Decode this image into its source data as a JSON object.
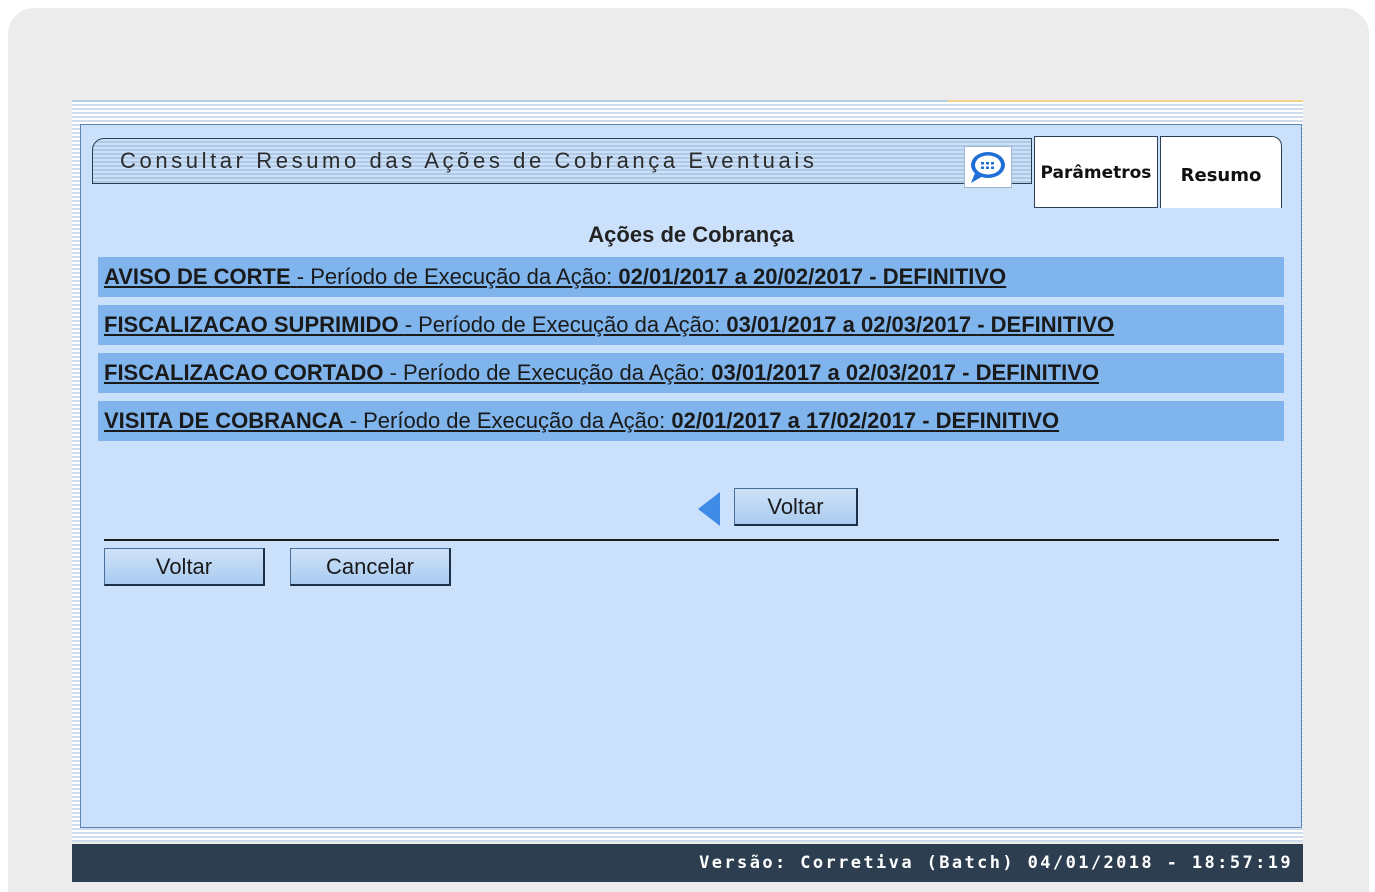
{
  "header": {
    "title": "Consultar Resumo das Ações de Cobrança Eventuais",
    "tabs": [
      {
        "label": "Parâmetros"
      },
      {
        "label": "Resumo"
      }
    ]
  },
  "main": {
    "heading": "Ações de Cobrança",
    "period_prefix": "- Período de Execução da Ação:",
    "separator": "a",
    "actions": [
      {
        "name": "AVISO DE CORTE",
        "start": "02/01/2017",
        "end": "20/02/2017",
        "status": "DEFINITIVO"
      },
      {
        "name": "FISCALIZACAO SUPRIMIDO",
        "start": "03/01/2017",
        "end": "02/03/2017",
        "status": "DEFINITIVO"
      },
      {
        "name": "FISCALIZACAO CORTADO",
        "start": "03/01/2017",
        "end": "02/03/2017",
        "status": "DEFINITIVO"
      },
      {
        "name": "VISITA DE COBRANCA",
        "start": "02/01/2017",
        "end": "17/02/2017",
        "status": "DEFINITIVO"
      }
    ],
    "back_button": "Voltar"
  },
  "buttons": {
    "voltar": "Voltar",
    "cancelar": "Cancelar"
  },
  "footer": {
    "version": "Versão: Corretiva (Batch) 04/01/2018 - 18:57:19"
  },
  "colors": {
    "panel_bg": "#cbe1fb",
    "row_bg": "#7fb4ec",
    "footer_bg": "#2c3e50",
    "arrow": "#3f8be8"
  },
  "icons": [
    "chat-icon",
    "back-arrow-icon"
  ]
}
